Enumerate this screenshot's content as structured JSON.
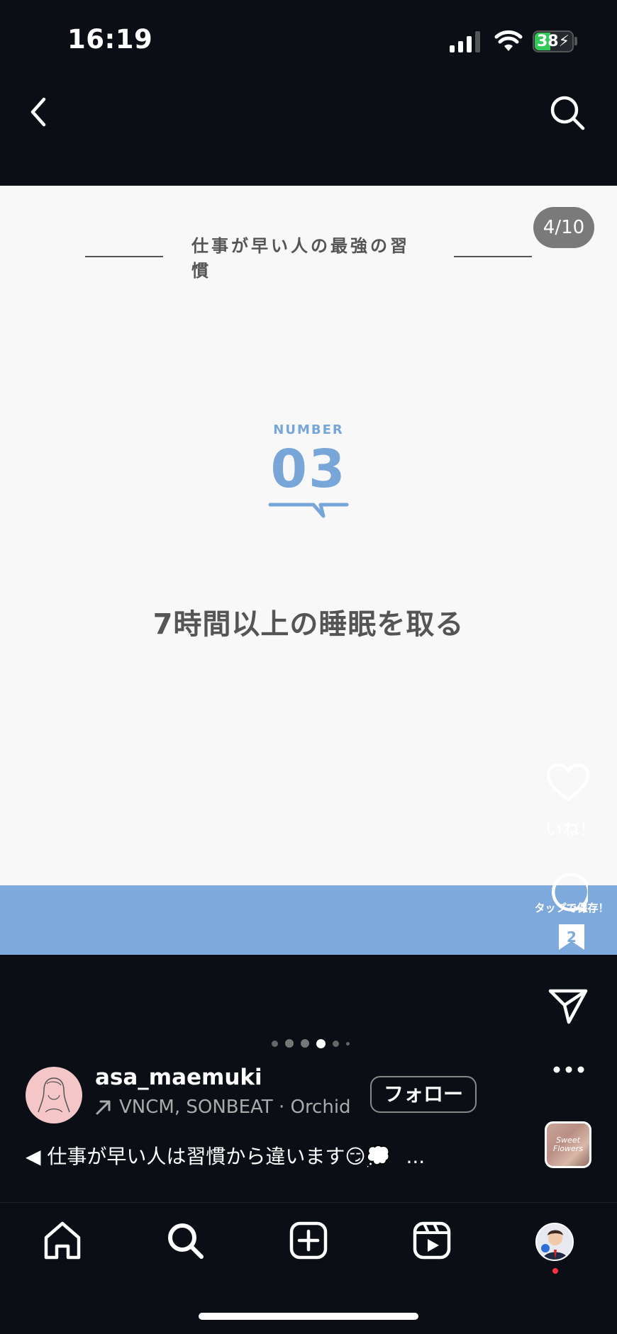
{
  "status_bar": {
    "time": "16:19",
    "battery": "38"
  },
  "slide": {
    "counter": "4/10",
    "title": "仕事が早い人の最強の習慣",
    "number_label": "NUMBER",
    "number": "03",
    "text": "7時間以上の睡眠を取る"
  },
  "actions": {
    "like_label": "いね！",
    "save_tip": "タップで保存！",
    "save_count": "2"
  },
  "music_thumb_text": "Sweet Flowers",
  "post": {
    "username": "asa_maemuki",
    "music": "VNCM, SONBEAT · Orchid",
    "follow_label": "フォロー",
    "caption": "◀ 仕事が早い人は習慣から違います😏💭",
    "caption_more": "..."
  },
  "colors": {
    "accent": "#7ea9dc",
    "background": "#0b0e14",
    "slide_bg": "#f8f8f8"
  }
}
